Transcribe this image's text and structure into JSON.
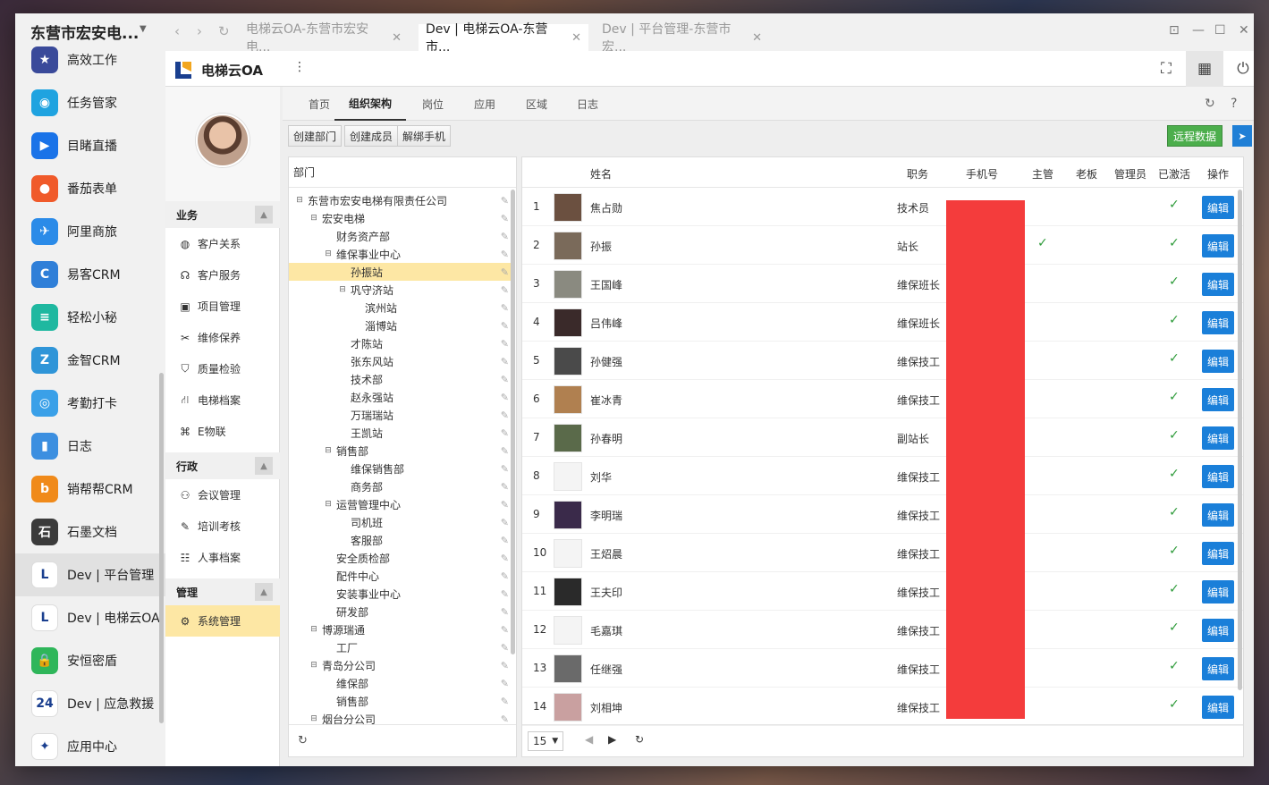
{
  "dock": {
    "title": "东营市宏安电...",
    "items": [
      {
        "label": "高效工作",
        "icon": "star-icon",
        "color": "#3a4a9a",
        "glyph": "★"
      },
      {
        "label": "任务管家",
        "icon": "task-icon",
        "color": "#1fa3e0",
        "glyph": "◉"
      },
      {
        "label": "目睹直播",
        "icon": "live-icon",
        "color": "#1a73e8",
        "glyph": "▶"
      },
      {
        "label": "番茄表单",
        "icon": "tomato-icon",
        "color": "#f05a2a",
        "glyph": "●"
      },
      {
        "label": "阿里商旅",
        "icon": "travel-icon",
        "color": "#2b8be8",
        "glyph": "✈"
      },
      {
        "label": "易客CRM",
        "icon": "crm-icon",
        "color": "#2f7fd8",
        "glyph": "C"
      },
      {
        "label": "轻松小秘",
        "icon": "secretary-icon",
        "color": "#1fb8a0",
        "glyph": "≡"
      },
      {
        "label": "金智CRM",
        "icon": "jinzhi-icon",
        "color": "#2f95d8",
        "glyph": "Z"
      },
      {
        "label": "考勤打卡",
        "icon": "attendance-icon",
        "color": "#3aa0e8",
        "glyph": "◎"
      },
      {
        "label": "日志",
        "icon": "log-icon",
        "color": "#3c8fe0",
        "glyph": "▮"
      },
      {
        "label": "销帮帮CRM",
        "icon": "xbb-icon",
        "color": "#f08a1a",
        "glyph": "b"
      },
      {
        "label": "石墨文档",
        "icon": "shimo-icon",
        "color": "#3b3b3b",
        "glyph": "石"
      },
      {
        "label": "Dev | 平台管理",
        "icon": "platform-icon",
        "color": "#ffffff",
        "glyph": "L"
      },
      {
        "label": "Dev | 电梯云OA",
        "icon": "elevator-oa-icon",
        "color": "#ffffff",
        "glyph": "L"
      },
      {
        "label": "安恒密盾",
        "icon": "lock-icon",
        "color": "#2fb65a",
        "glyph": "🔒"
      },
      {
        "label": "Dev | 应急救援",
        "icon": "rescue-icon",
        "color": "#ffffff",
        "glyph": "24"
      },
      {
        "label": "应用中心",
        "icon": "app-center-icon",
        "color": "#ffffff",
        "glyph": "✦"
      }
    ]
  },
  "browser": {
    "tabs": [
      {
        "label": "电梯云OA-东营市宏安电..."
      },
      {
        "label": "Dev | 电梯云OA-东营市..."
      },
      {
        "label": "Dev | 平台管理-东营市宏..."
      }
    ]
  },
  "app": {
    "name": "电梯云OA",
    "kebab": "⋮"
  },
  "sidebar": {
    "sections": [
      {
        "title": "业务",
        "items": [
          {
            "label": "客户关系",
            "icon": "crm-badge-icon",
            "glyph": "◍"
          },
          {
            "label": "客户服务",
            "icon": "headset-icon",
            "glyph": "☊"
          },
          {
            "label": "项目管理",
            "icon": "project-icon",
            "glyph": "▣"
          },
          {
            "label": "维修保养",
            "icon": "tools-icon",
            "glyph": "✂"
          },
          {
            "label": "质量检验",
            "icon": "shield-icon",
            "glyph": "⛉"
          },
          {
            "label": "电梯档案",
            "icon": "elevator-file-icon",
            "glyph": "⛙"
          },
          {
            "label": "E物联",
            "icon": "iot-icon",
            "glyph": "⌘"
          }
        ]
      },
      {
        "title": "行政",
        "items": [
          {
            "label": "会议管理",
            "icon": "meeting-icon",
            "glyph": "⚇"
          },
          {
            "label": "培训考核",
            "icon": "training-icon",
            "glyph": "✎"
          },
          {
            "label": "人事档案",
            "icon": "personnel-icon",
            "glyph": "☷"
          }
        ]
      },
      {
        "title": "管理",
        "items": [
          {
            "label": "系统管理",
            "icon": "settings-gear-icon",
            "glyph": "⚙"
          }
        ]
      }
    ]
  },
  "subtabs": [
    "首页",
    "组织架构",
    "岗位",
    "应用",
    "区域",
    "日志"
  ],
  "toolbar": {
    "create_dept": "创建部门",
    "create_member": "创建成员",
    "unbind_phone": "解绑手机",
    "remote_data": "远程数据"
  },
  "tree": {
    "header": "部门",
    "nodes": [
      {
        "label": "东营市宏安电梯有限责任公司",
        "depth": 0,
        "toggle": "⊟"
      },
      {
        "label": "宏安电梯",
        "depth": 1,
        "toggle": "⊟"
      },
      {
        "label": "财务资产部",
        "depth": 2,
        "toggle": ""
      },
      {
        "label": "维保事业中心",
        "depth": 2,
        "toggle": "⊟"
      },
      {
        "label": "孙振站",
        "depth": 3,
        "toggle": "",
        "selected": true
      },
      {
        "label": "巩守济站",
        "depth": 3,
        "toggle": "⊟"
      },
      {
        "label": "滨州站",
        "depth": 4,
        "toggle": ""
      },
      {
        "label": "淄博站",
        "depth": 4,
        "toggle": ""
      },
      {
        "label": "才陈站",
        "depth": 3,
        "toggle": ""
      },
      {
        "label": "张东风站",
        "depth": 3,
        "toggle": ""
      },
      {
        "label": "技术部",
        "depth": 3,
        "toggle": ""
      },
      {
        "label": "赵永强站",
        "depth": 3,
        "toggle": ""
      },
      {
        "label": "万瑞瑞站",
        "depth": 3,
        "toggle": ""
      },
      {
        "label": "王凯站",
        "depth": 3,
        "toggle": ""
      },
      {
        "label": "销售部",
        "depth": 2,
        "toggle": "⊟"
      },
      {
        "label": "维保销售部",
        "depth": 3,
        "toggle": ""
      },
      {
        "label": "商务部",
        "depth": 3,
        "toggle": ""
      },
      {
        "label": "运营管理中心",
        "depth": 2,
        "toggle": "⊟"
      },
      {
        "label": "司机班",
        "depth": 3,
        "toggle": ""
      },
      {
        "label": "客服部",
        "depth": 3,
        "toggle": ""
      },
      {
        "label": "安全质检部",
        "depth": 2,
        "toggle": ""
      },
      {
        "label": "配件中心",
        "depth": 2,
        "toggle": ""
      },
      {
        "label": "安装事业中心",
        "depth": 2,
        "toggle": ""
      },
      {
        "label": "研发部",
        "depth": 2,
        "toggle": ""
      },
      {
        "label": "博源瑞通",
        "depth": 1,
        "toggle": "⊟"
      },
      {
        "label": "工厂",
        "depth": 2,
        "toggle": ""
      },
      {
        "label": "青岛分公司",
        "depth": 1,
        "toggle": "⊟"
      },
      {
        "label": "维保部",
        "depth": 2,
        "toggle": ""
      },
      {
        "label": "销售部",
        "depth": 2,
        "toggle": ""
      },
      {
        "label": "烟台分公司",
        "depth": 1,
        "toggle": "⊟"
      }
    ]
  },
  "grid": {
    "columns": {
      "name": "姓名",
      "position": "职务",
      "phone": "手机号",
      "supervisor": "主管",
      "boss": "老板",
      "admin": "管理员",
      "activated": "已激活",
      "action": "操作"
    },
    "edit_label": "编辑",
    "check": "✓",
    "rows": [
      {
        "no": "1",
        "name": "焦占勋",
        "position": "技术员",
        "supervisor": false,
        "photo": "#6b5040"
      },
      {
        "no": "2",
        "name": "孙振",
        "position": "站长",
        "supervisor": true,
        "photo": "#7a6a5a"
      },
      {
        "no": "3",
        "name": "王国峰",
        "position": "维保班长",
        "supervisor": false,
        "photo": "#8a8a80"
      },
      {
        "no": "4",
        "name": "吕伟峰",
        "position": "维保班长",
        "supervisor": false,
        "photo": "#3a2a2a"
      },
      {
        "no": "5",
        "name": "孙健强",
        "position": "维保技工",
        "supervisor": false,
        "photo": "#4a4a4a"
      },
      {
        "no": "6",
        "name": "崔冰青",
        "position": "维保技工",
        "supervisor": false,
        "photo": "#b08050"
      },
      {
        "no": "7",
        "name": "孙春明",
        "position": "副站长",
        "supervisor": false,
        "photo": "#5a6a4a"
      },
      {
        "no": "8",
        "name": "刘华",
        "position": "维保技工",
        "supervisor": false,
        "photo": "#f4f4f4"
      },
      {
        "no": "9",
        "name": "李明瑞",
        "position": "维保技工",
        "supervisor": false,
        "photo": "#3a2a4a"
      },
      {
        "no": "10",
        "name": "王炤晨",
        "position": "维保技工",
        "supervisor": false,
        "photo": "#f4f4f4"
      },
      {
        "no": "11",
        "name": "王夫印",
        "position": "维保技工",
        "supervisor": false,
        "photo": "#2a2a2a"
      },
      {
        "no": "12",
        "name": "毛嘉琪",
        "position": "维保技工",
        "supervisor": false,
        "photo": "#f4f4f4"
      },
      {
        "no": "13",
        "name": "任继强",
        "position": "维保技工",
        "supervisor": false,
        "photo": "#6a6a6a"
      },
      {
        "no": "14",
        "name": "刘相坤",
        "position": "维保技工",
        "supervisor": false,
        "photo": "#c9a0a0"
      }
    ],
    "page_size": "15"
  }
}
